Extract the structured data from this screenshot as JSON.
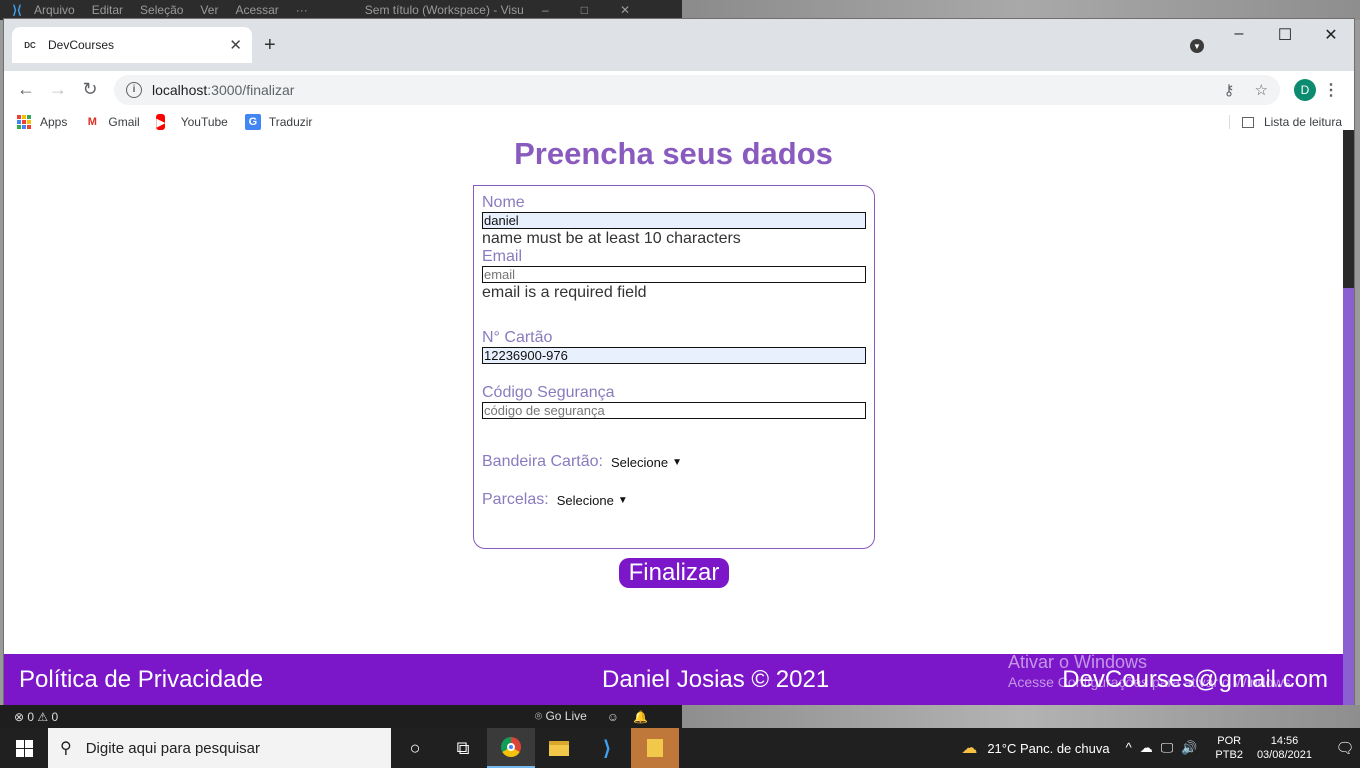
{
  "vscode": {
    "menu": [
      "Arquivo",
      "Editar",
      "Seleção",
      "Ver",
      "Acessar",
      "···"
    ],
    "title": "Sem título (Workspace) - Visu",
    "status_problems": "⊗ 0 ⚠ 0",
    "go_live": "Go Live"
  },
  "browser": {
    "tab_title": "DevCourses",
    "tab_favicon": "DC",
    "url_host": "localhost",
    "url_path": ":3000/finalizar",
    "profile_initial": "D",
    "bookmarks": [
      {
        "label": "Apps",
        "icon": "apps-icon"
      },
      {
        "label": "Gmail",
        "icon": "gmail-icon"
      },
      {
        "label": "YouTube",
        "icon": "youtube-icon"
      },
      {
        "label": "Traduzir",
        "icon": "translate-icon"
      }
    ],
    "reading_list": "Lista de leitura"
  },
  "page": {
    "title": "Preencha seus dados",
    "form": {
      "nome_label": "Nome",
      "nome_value": "daniel",
      "nome_error": "name must be at least 10 characters",
      "email_label": "Email",
      "email_placeholder": "email",
      "email_error": "email is a required field",
      "cartao_label": "N° Cartão",
      "cartao_value": "12236900-976",
      "codigo_label": "Código Segurança",
      "codigo_placeholder": "código de segurança",
      "bandeira_label": "Bandeira Cartão:",
      "bandeira_selected": "Selecione",
      "parcelas_label": "Parcelas:",
      "parcelas_selected": "Selecione"
    },
    "submit_label": "Finalizar",
    "footer": {
      "privacy": "Política de Privacidade",
      "copyright": "Daniel Josias © 2021",
      "email": "DevCourses@gmail.com"
    },
    "watermark": {
      "line1": "Ativar o Windows",
      "line2": "Acesse Configurações para ativar o Windows."
    }
  },
  "taskbar": {
    "search_placeholder": "Digite aqui para pesquisar",
    "weather": "21°C  Panc. de chuva",
    "lang_1": "POR",
    "lang_2": "PTB2",
    "time": "14:56",
    "date": "03/08/2021"
  },
  "colors": {
    "accent_purple": "#7b16c9",
    "title_purple": "#8a5bbf"
  }
}
